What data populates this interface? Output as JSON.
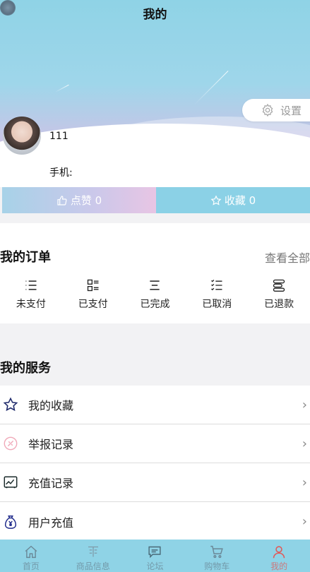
{
  "header": {
    "title": "我的"
  },
  "profile": {
    "name": "111",
    "phone_label": "手机:",
    "settings_label": "设置"
  },
  "stats": {
    "likes_label": "点赞 0",
    "favorites_label": "收藏 0"
  },
  "orders": {
    "title": "我的订单",
    "view_all": "查看全部",
    "items": [
      {
        "label": "未支付",
        "icon": "list-icon"
      },
      {
        "label": "已支付",
        "icon": "grid-list-icon"
      },
      {
        "label": "已完成",
        "icon": "lines-icon"
      },
      {
        "label": "已取消",
        "icon": "checklist-icon"
      },
      {
        "label": "已退款",
        "icon": "refund-icon"
      }
    ]
  },
  "services": {
    "title": "我的服务",
    "items": [
      {
        "label": "我的收藏",
        "icon": "star-icon"
      },
      {
        "label": "举报记录",
        "icon": "report-icon"
      },
      {
        "label": "充值记录",
        "icon": "chart-icon"
      },
      {
        "label": "用户充值",
        "icon": "money-bag-icon"
      }
    ]
  },
  "tabbar": {
    "items": [
      {
        "label": "首页",
        "icon": "home-icon"
      },
      {
        "label": "商品信息",
        "icon": "goods-icon"
      },
      {
        "label": "论坛",
        "icon": "chat-icon"
      },
      {
        "label": "购物车",
        "icon": "cart-icon"
      },
      {
        "label": "我的",
        "icon": "person-icon",
        "active": true
      }
    ]
  },
  "colors": {
    "accent": "#8fd3e6",
    "active_tab": "#e05a5a"
  }
}
